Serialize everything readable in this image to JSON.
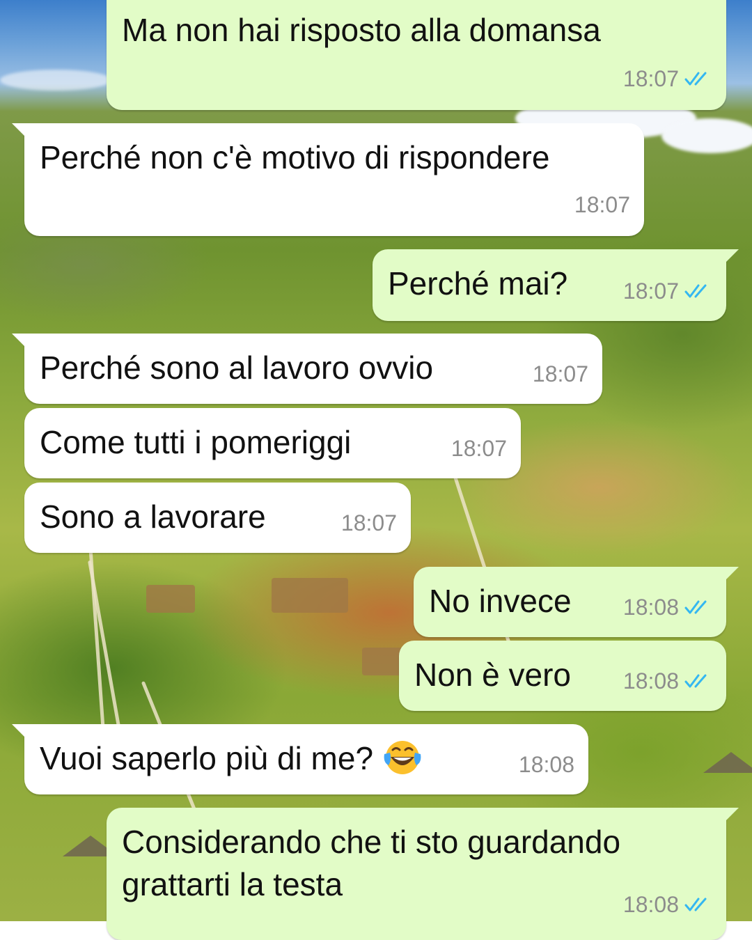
{
  "wallpaper": {
    "description_icon": "tropical-hillside-wallpaper"
  },
  "colors": {
    "outgoing_bubble": "#e2fcc7",
    "incoming_bubble": "#ffffff",
    "read_ticks": "#34b7f1",
    "timestamp": "#8c8c8c"
  },
  "messages": [
    {
      "direction": "out",
      "text": "Ma non hai risposto alla domansa",
      "time": "18:07",
      "status": "read"
    },
    {
      "direction": "in",
      "text": "Perché non c'è motivo di rispondere",
      "time": "18:07"
    },
    {
      "direction": "out",
      "text": "Perché mai?",
      "time": "18:07",
      "status": "read"
    },
    {
      "direction": "in",
      "text": "Perché sono al lavoro ovvio",
      "time": "18:07"
    },
    {
      "direction": "in",
      "text": "Come tutti i pomeriggi",
      "time": "18:07"
    },
    {
      "direction": "in",
      "text": "Sono a lavorare",
      "time": "18:07"
    },
    {
      "direction": "out",
      "text": "No invece",
      "time": "18:08",
      "status": "read"
    },
    {
      "direction": "out",
      "text": "Non è vero",
      "time": "18:08",
      "status": "read"
    },
    {
      "direction": "in",
      "text": "Vuoi saperlo più di me?",
      "emoji": "face-with-tears-of-joy",
      "time": "18:08"
    },
    {
      "direction": "out",
      "text_lines": [
        "Considerando che ti sto guardando",
        "grattarti la testa"
      ],
      "time": "18:08",
      "status": "read"
    }
  ]
}
